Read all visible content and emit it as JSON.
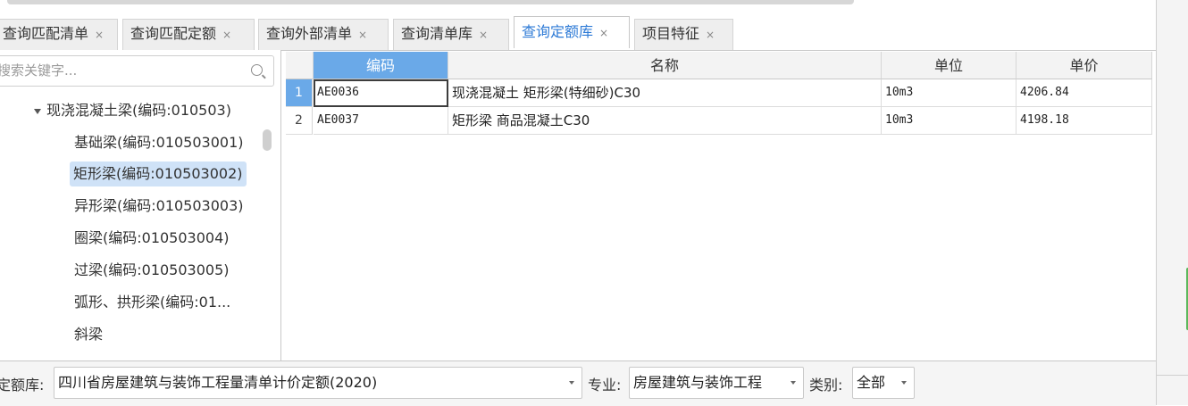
{
  "tabs": [
    {
      "label": "查询匹配清单",
      "active": false
    },
    {
      "label": "查询匹配定额",
      "active": false
    },
    {
      "label": "查询外部清单",
      "active": false
    },
    {
      "label": "查询清单库",
      "active": false
    },
    {
      "label": "查询定额库",
      "active": true
    },
    {
      "label": "项目特征",
      "active": false
    }
  ],
  "tab_close_glyph": "×",
  "search": {
    "placeholder": "搜索关键字..."
  },
  "tree": {
    "parent": "现浇混凝土梁(编码:010503)",
    "children": [
      {
        "label": "基础梁(编码:010503001)",
        "selected": false
      },
      {
        "label": "矩形梁(编码:010503002)",
        "selected": true
      },
      {
        "label": "异形梁(编码:010503003)",
        "selected": false
      },
      {
        "label": "圈梁(编码:010503004)",
        "selected": false
      },
      {
        "label": "过梁(编码:010503005)",
        "selected": false
      },
      {
        "label": "弧形、拱形梁(编码:01...",
        "selected": false
      },
      {
        "label": "斜梁",
        "selected": false
      }
    ]
  },
  "table": {
    "columns": [
      "编码",
      "名称",
      "单位",
      "单价"
    ],
    "rows": [
      {
        "num": "1",
        "code": "AE0036",
        "name": "现浇混凝土 矩形梁(特细砂)C30",
        "unit": "10m3",
        "price": "4206.84"
      },
      {
        "num": "2",
        "code": "AE0037",
        "name": "矩形梁 商品混凝土C30",
        "unit": "10m3",
        "price": "4198.18"
      }
    ]
  },
  "bottom": {
    "library_label": "定额库:",
    "library_value": "四川省房屋建筑与装饰工程量清单计价定额(2020)",
    "major_label": "专业:",
    "major_value": "房屋建筑与装饰工程",
    "category_label": "类别:",
    "category_value": "全部"
  },
  "colors": {
    "accent": "#2d7ad6",
    "header_selected": "#6aa9e8",
    "tree_selected": "#cfe2f7"
  }
}
